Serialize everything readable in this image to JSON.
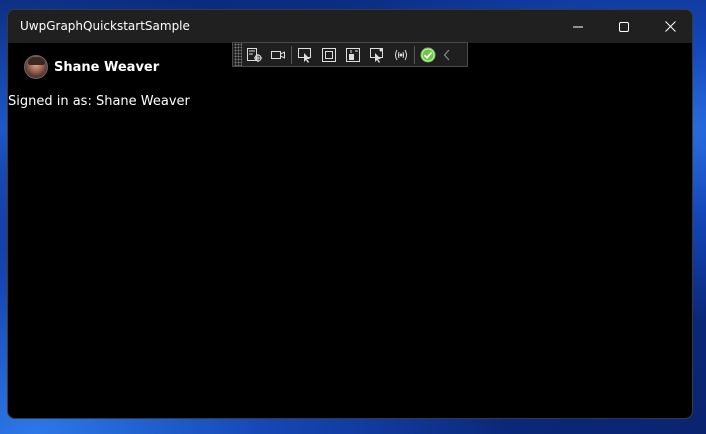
{
  "window": {
    "title": "UwpGraphQuickstartSample"
  },
  "caption_buttons": {
    "minimize_icon": "minimize-icon",
    "maximize_icon": "maximize-icon",
    "close_icon": "close-icon"
  },
  "debug_toolbar": {
    "icons": [
      "go-to-live-visual-tree-icon",
      "show-in-app-toolbar-icon",
      "select-element-icon",
      "display-layout-adorners-icon",
      "track-focused-element-icon",
      "hot-reload-icon",
      "binding-failures-icon",
      "accessibility-check-icon",
      "collapse-toolbar-icon"
    ]
  },
  "person": {
    "name": "Shane Weaver"
  },
  "status": {
    "signed_in_text": "Signed in as: Shane Weaver"
  },
  "colors": {
    "titlebar_bg": "#202020",
    "window_bg": "#000000",
    "text": "#ffffff",
    "check_green": "#6cc644"
  }
}
